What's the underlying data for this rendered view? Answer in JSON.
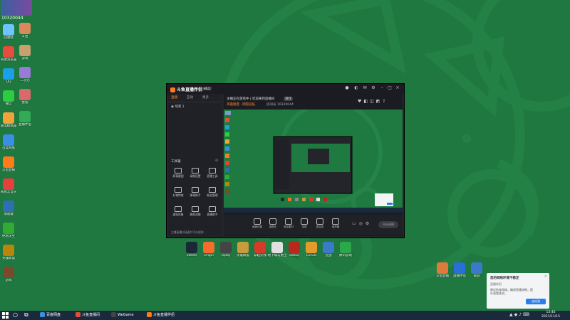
{
  "desktop": {
    "top_banner": {
      "text": "10320044"
    },
    "icons_col1": [
      {
        "label": "回收站",
        "icon": "recycle-bin-icon",
        "color": "#6fc3ff"
      },
      {
        "label": "谷歌浏览器",
        "icon": "chrome-icon",
        "color": "#e94b3c"
      },
      {
        "label": "QQ",
        "icon": "qq-icon",
        "color": "#1aa0e8"
      },
      {
        "label": "微信",
        "icon": "wechat-icon",
        "color": "#2ecc40"
      },
      {
        "label": "雷电模拟器",
        "icon": "emulator-icon",
        "color": "#f2a23a"
      },
      {
        "label": "百度网盘",
        "icon": "cloud-icon",
        "color": "#3a8ee6"
      },
      {
        "label": "斗鱼直播",
        "icon": "douyu-icon",
        "color": "#ff7a1a"
      },
      {
        "label": "网易云音乐",
        "icon": "music-icon",
        "color": "#e83e3e"
      },
      {
        "label": "加速器",
        "icon": "accelerator-icon",
        "color": "#2d6fb2"
      },
      {
        "label": "绝地求生",
        "icon": "pubg-icon",
        "color": "#33aa33"
      },
      {
        "label": "英雄联盟",
        "icon": "lol-icon",
        "color": "#b8860b"
      },
      {
        "label": "游戏",
        "icon": "game-icon",
        "color": "#7a4a2a"
      }
    ],
    "icons_col2": [
      {
        "label": "斗鱼",
        "icon": "avatar-icon",
        "color": "#d9895b"
      },
      {
        "label": "游戏",
        "icon": "game-icon",
        "color": "#c8a070"
      },
      {
        "label": "二次元",
        "icon": "anime-icon",
        "color": "#9a7ad8"
      },
      {
        "label": "壁纸",
        "icon": "wallpaper-icon",
        "color": "#d86a6a"
      },
      {
        "label": "直播伴侣",
        "icon": "live-icon",
        "color": "#33aa55"
      }
    ],
    "center_icons": [
      {
        "label": "Steam",
        "icon": "steam-icon",
        "color": "#1b2838"
      },
      {
        "label": "Origin",
        "icon": "origin-icon",
        "color": "#f56c2d"
      },
      {
        "label": "Uplay",
        "icon": "uplay-icon",
        "color": "#444"
      },
      {
        "label": "英雄联盟",
        "icon": "lol-icon",
        "color": "#c89b3c"
      },
      {
        "label": "穿越火线",
        "icon": "cf-icon",
        "color": "#d83a2a"
      },
      {
        "label": "地下城与勇士",
        "icon": "dnf-icon",
        "color": "#e0e0e0"
      },
      {
        "label": "Dota2",
        "icon": "dota-icon",
        "color": "#b8281f"
      },
      {
        "label": "CS:GO",
        "icon": "csgo-icon",
        "color": "#e59a2b"
      },
      {
        "label": "逆战",
        "icon": "game-icon",
        "color": "#3a7ac8"
      },
      {
        "label": "腾讯游戏",
        "icon": "play-icon",
        "color": "#2aa84a"
      }
    ],
    "right_icons": [
      {
        "label": "斗鱼直播",
        "icon": "douyu-icon",
        "color": "#e07a3a"
      },
      {
        "label": "直播伴侣",
        "icon": "tv-icon",
        "color": "#2a6ed8"
      },
      {
        "label": "录屏",
        "icon": "screen-icon",
        "color": "#3a7ac8"
      }
    ]
  },
  "app": {
    "title": "斗鱼直播伴侣",
    "version": "v6.2",
    "tabs": [
      "直播",
      "互动",
      "更多"
    ],
    "scene_label": "场景 1",
    "tools_title": "工具箱",
    "tools": [
      {
        "label": "屏幕截图",
        "icon": "screenshot-icon"
      },
      {
        "label": "录制设置",
        "icon": "record-icon"
      },
      {
        "label": "直播工具",
        "icon": "tool-icon"
      },
      {
        "label": "礼物特效",
        "icon": "gift-icon"
      },
      {
        "label": "弹幕助手",
        "icon": "danmaku-icon"
      },
      {
        "label": "粉丝管理",
        "icon": "fans-icon"
      },
      {
        "label": "虚拟形象",
        "icon": "avatar-icon"
      },
      {
        "label": "美颜滤镜",
        "icon": "beauty-icon"
      },
      {
        "label": "直播助手",
        "icon": "assistant-icon"
      }
    ],
    "bottom_note": "主播直播时请遵守平台规则",
    "stream_title": "主播正在游戏中 | 欢迎来到直播间",
    "stream_tag": "游戏",
    "category": "英雄联盟 · 网游竞技",
    "room_info": "房间号 10320044",
    "controls": [
      {
        "label": "画面设置",
        "icon": "monitor-icon"
      },
      {
        "label": "摄像头",
        "icon": "camera-icon"
      },
      {
        "label": "添加素材",
        "icon": "media-icon"
      },
      {
        "label": "录屏",
        "icon": "video-icon"
      },
      {
        "label": "麦克风",
        "icon": "mic-icon"
      },
      {
        "label": "扬声器",
        "icon": "speaker-icon"
      }
    ],
    "start_button": "开始直播"
  },
  "taskbar": {
    "items": [
      {
        "label": "百度网盘",
        "icon": "cloud-icon",
        "color": "#3a8ee6"
      },
      {
        "label": "斗鱼直播间",
        "icon": "chrome-icon",
        "color": "#e94b3c"
      },
      {
        "label": "WeGame",
        "icon": "wegame-icon",
        "color": "#444"
      },
      {
        "label": "斗鱼直播伴侣",
        "icon": "douyu-icon",
        "color": "#ff7a1a"
      }
    ],
    "time": "13:46",
    "date": "2021/11/15"
  },
  "notification": {
    "title": "您的网络环境不稳定",
    "subtitle": "直播伴侣",
    "body": "建议检查网络，确保直播流畅，提升观看体验。",
    "button": "去检测"
  },
  "colors": {
    "wallpaper": "#1e783f",
    "accent": "#ff7a1a"
  }
}
